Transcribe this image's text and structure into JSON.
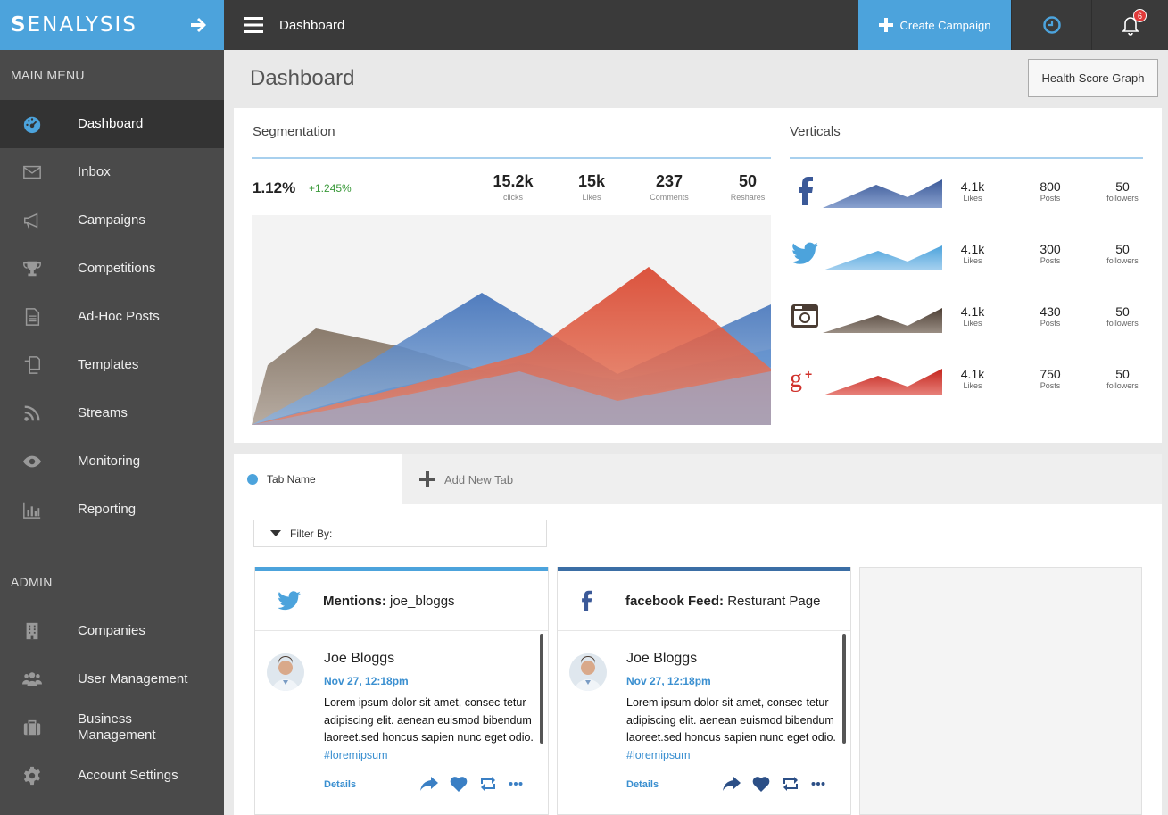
{
  "brand": {
    "logo_bold": "S",
    "logo_rest": "ENALYSIS"
  },
  "sidebar": {
    "main_label": "MAIN MENU",
    "main_items": [
      {
        "label": "Dashboard",
        "icon": "speedometer-icon"
      },
      {
        "label": "Inbox",
        "icon": "envelope-icon"
      },
      {
        "label": "Campaigns",
        "icon": "megaphone-icon"
      },
      {
        "label": "Competitions",
        "icon": "trophy-icon"
      },
      {
        "label": "Ad-Hoc Posts",
        "icon": "document-icon"
      },
      {
        "label": "Templates",
        "icon": "copy-icon"
      },
      {
        "label": "Streams",
        "icon": "rss-icon"
      },
      {
        "label": "Monitoring",
        "icon": "eye-icon"
      },
      {
        "label": "Reporting",
        "icon": "bar-chart-icon"
      }
    ],
    "admin_label": "ADMIN",
    "admin_items": [
      {
        "label": "Companies",
        "icon": "building-icon"
      },
      {
        "label": "User Management",
        "icon": "users-icon"
      },
      {
        "label": "Business Management",
        "icon": "briefcase-icon"
      },
      {
        "label": "Account Settings",
        "icon": "gear-icon"
      }
    ]
  },
  "topbar": {
    "title": "Dashboard",
    "create_label": "Create Campaign",
    "notification_count": "6"
  },
  "page": {
    "title": "Dashboard",
    "health_button": "Health Score Graph"
  },
  "segmentation": {
    "title": "Segmentation",
    "rate": "1.12%",
    "delta": "+1.245%",
    "stats": [
      {
        "value": "15.2k",
        "label": "clicks"
      },
      {
        "value": "15k",
        "label": "Likes"
      },
      {
        "value": "237",
        "label": "Comments"
      },
      {
        "value": "50",
        "label": "Reshares"
      }
    ]
  },
  "verticals": {
    "title": "Verticals",
    "rows": [
      {
        "network": "facebook",
        "likes": "4.1k",
        "likes_label": "Likes",
        "posts": "800",
        "posts_label": "Posts",
        "followers": "50",
        "followers_label": "followers",
        "color": "#3b5998"
      },
      {
        "network": "twitter",
        "likes": "4.1k",
        "likes_label": "Likes",
        "posts": "300",
        "posts_label": "Posts",
        "followers": "50",
        "followers_label": "followers",
        "color": "#4ca3dc"
      },
      {
        "network": "instagram",
        "likes": "4.1k",
        "likes_label": "Likes",
        "posts": "430",
        "posts_label": "Posts",
        "followers": "50",
        "followers_label": "followers",
        "color": "#5a4a40"
      },
      {
        "network": "google-plus",
        "likes": "4.1k",
        "likes_label": "Likes",
        "posts": "750",
        "posts_label": "Posts",
        "followers": "50",
        "followers_label": "followers",
        "color": "#d0302a"
      }
    ]
  },
  "tabs": {
    "active": "Tab Name",
    "add": "Add New Tab"
  },
  "filter": {
    "label": "Filter By:"
  },
  "feeds": [
    {
      "title_bold": "Mentions:",
      "title_rest": " joe_bloggs",
      "network": "twitter",
      "accent": "#4ca3dc",
      "post": {
        "name": "Joe Bloggs",
        "time": "Nov 27, 12:18pm",
        "text": "Lorem ipsum dolor sit amet, consec-tetur adipiscing elit. aenean euismod bibendum laoreet.sed honcus sapien nunc eget odio. ",
        "tag": "#loremipsum",
        "details": "Details"
      }
    },
    {
      "title_bold": "facebook Feed:",
      "title_rest": " Resturant Page",
      "network": "facebook",
      "accent": "#3b6ea5",
      "post": {
        "name": "Joe Bloggs",
        "time": "Nov 27, 12:18pm",
        "text": "Lorem ipsum dolor sit amet, consec-tetur adipiscing elit. aenean euismod bibendum laoreet.sed honcus sapien nunc eget odio. ",
        "tag": "#loremipsum",
        "details": "Details"
      }
    }
  ]
}
